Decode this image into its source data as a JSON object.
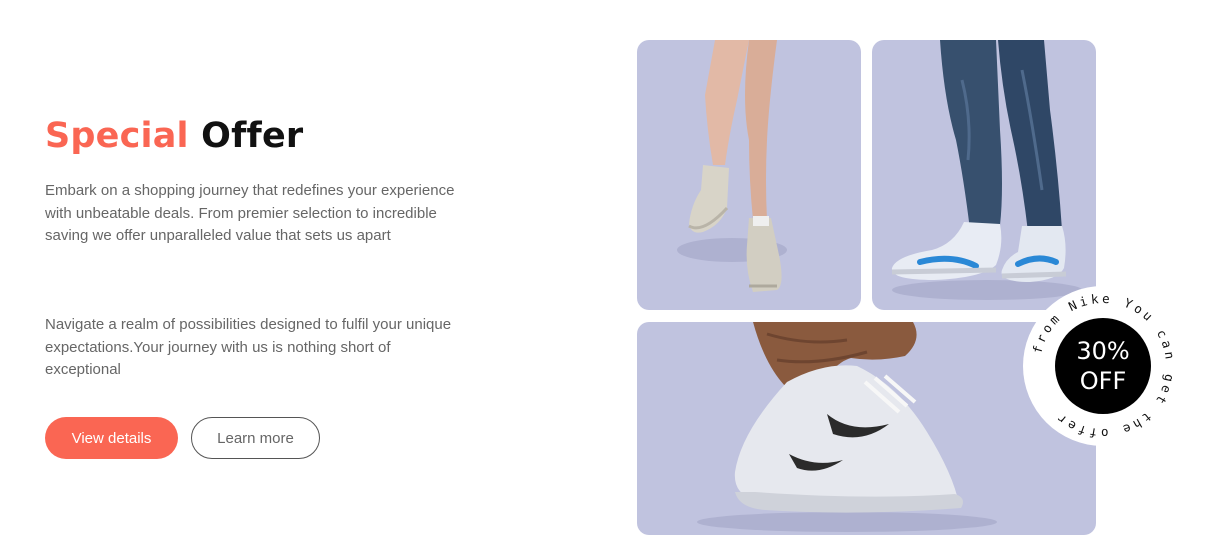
{
  "offer": {
    "title_accent": "Special",
    "title_rest": "Offer",
    "paragraph1": "Embark on a shopping journey that redefines your experience with unbeatable deals. From premier selection to incredible saving we offer unparalleled value that sets us apart",
    "paragraph2": "Navigate a realm of possibilities designed to fulfil your unique expectations.Your journey with us is nothing short of exceptional",
    "primary_button": "View details",
    "secondary_button": "Learn more"
  },
  "badge": {
    "line1": "30%",
    "line2": "OFF",
    "ring_text": "from Nike You can get the offer"
  },
  "colors": {
    "accent": "#fa6653",
    "card_background": "#c0c3df",
    "title_dark": "#111111",
    "text_gray": "#666666"
  },
  "images": [
    {
      "name": "legs-in-sneakers-image"
    },
    {
      "name": "jeans-with-blue-sneakers-image"
    },
    {
      "name": "white-nike-sneaker-image"
    }
  ]
}
